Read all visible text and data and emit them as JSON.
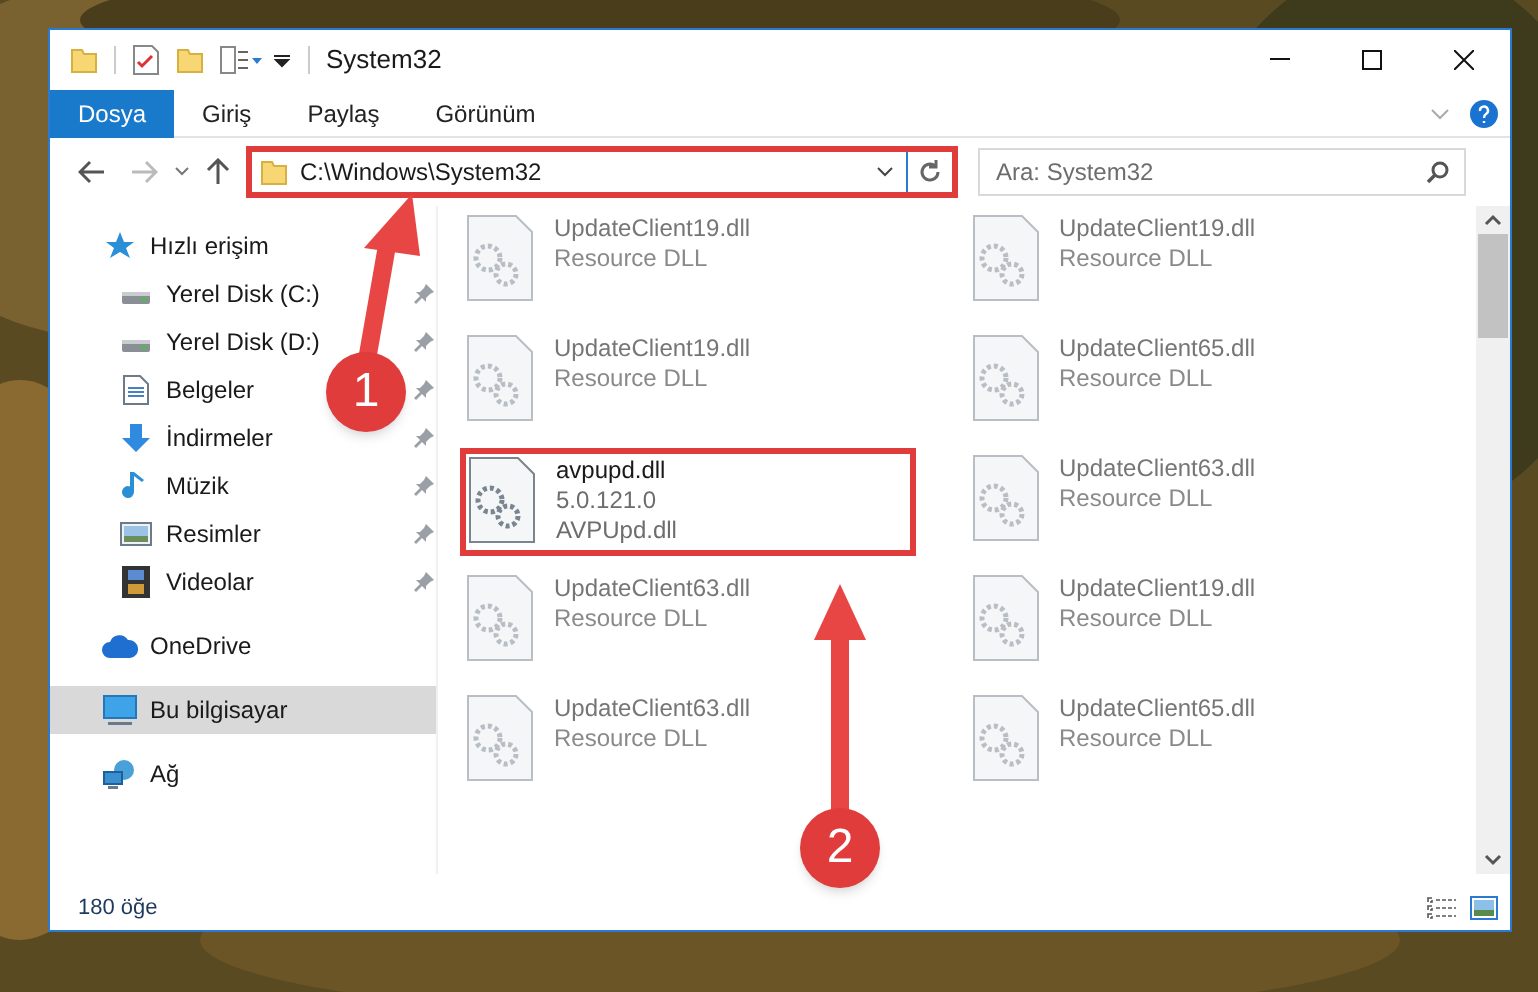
{
  "window": {
    "title": "System32"
  },
  "ribbon_tabs": [
    {
      "label": "Dosya",
      "selected": true
    },
    {
      "label": "Giriş",
      "selected": false
    },
    {
      "label": "Paylaş",
      "selected": false
    },
    {
      "label": "Görünüm",
      "selected": false
    }
  ],
  "address_bar": {
    "value": "C:\\Windows\\System32",
    "highlighted": true
  },
  "search": {
    "placeholder": "Ara: System32"
  },
  "sidebar": {
    "items": [
      {
        "label": "Hızlı erişim",
        "kind": "star",
        "selected": false,
        "children": [
          {
            "label": "Yerel Disk (C:)",
            "kind": "drive",
            "pinned": true,
            "selected": false
          },
          {
            "label": "Yerel Disk (D:)",
            "kind": "drive",
            "pinned": true,
            "selected": false
          },
          {
            "label": "Belgeler",
            "kind": "documents",
            "pinned": true,
            "selected": false
          },
          {
            "label": "İndirmeler",
            "kind": "download",
            "pinned": true,
            "selected": false
          },
          {
            "label": "Müzik",
            "kind": "music",
            "pinned": true,
            "selected": false
          },
          {
            "label": "Resimler",
            "kind": "pictures",
            "pinned": true,
            "selected": false
          },
          {
            "label": "Videolar",
            "kind": "videos",
            "pinned": true,
            "selected": false
          }
        ]
      },
      {
        "label": "OneDrive",
        "kind": "cloud",
        "selected": false
      },
      {
        "label": "Bu bilgisayar",
        "kind": "computer",
        "selected": true
      },
      {
        "label": "Ağ",
        "kind": "network",
        "selected": false
      }
    ]
  },
  "files": [
    {
      "name": "UpdateClient19.dll",
      "lines": [
        "Resource DLL"
      ],
      "blurred": true,
      "highlighted": false
    },
    {
      "name": "UpdateClient19.dll",
      "lines": [
        "Resource DLL"
      ],
      "blurred": true,
      "highlighted": false
    },
    {
      "name": "UpdateClient19.dll",
      "lines": [
        "Resource DLL"
      ],
      "blurred": true,
      "highlighted": false
    },
    {
      "name": "UpdateClient65.dll",
      "lines": [
        "Resource DLL"
      ],
      "blurred": true,
      "highlighted": false
    },
    {
      "name": "avpupd.dll",
      "lines": [
        "5.0.121.0",
        "AVPUpd.dll"
      ],
      "blurred": false,
      "highlighted": true
    },
    {
      "name": "UpdateClient63.dll",
      "lines": [
        "Resource DLL"
      ],
      "blurred": true,
      "highlighted": false
    },
    {
      "name": "UpdateClient63.dll",
      "lines": [
        "Resource DLL"
      ],
      "blurred": true,
      "highlighted": false
    },
    {
      "name": "UpdateClient19.dll",
      "lines": [
        "Resource DLL"
      ],
      "blurred": true,
      "highlighted": false
    },
    {
      "name": "UpdateClient63.dll",
      "lines": [
        "Resource DLL"
      ],
      "blurred": true,
      "highlighted": false
    },
    {
      "name": "UpdateClient65.dll",
      "lines": [
        "Resource DLL"
      ],
      "blurred": true,
      "highlighted": false
    }
  ],
  "status_bar": {
    "item_count": "180 öğe"
  },
  "callouts": [
    "1",
    "2"
  ]
}
